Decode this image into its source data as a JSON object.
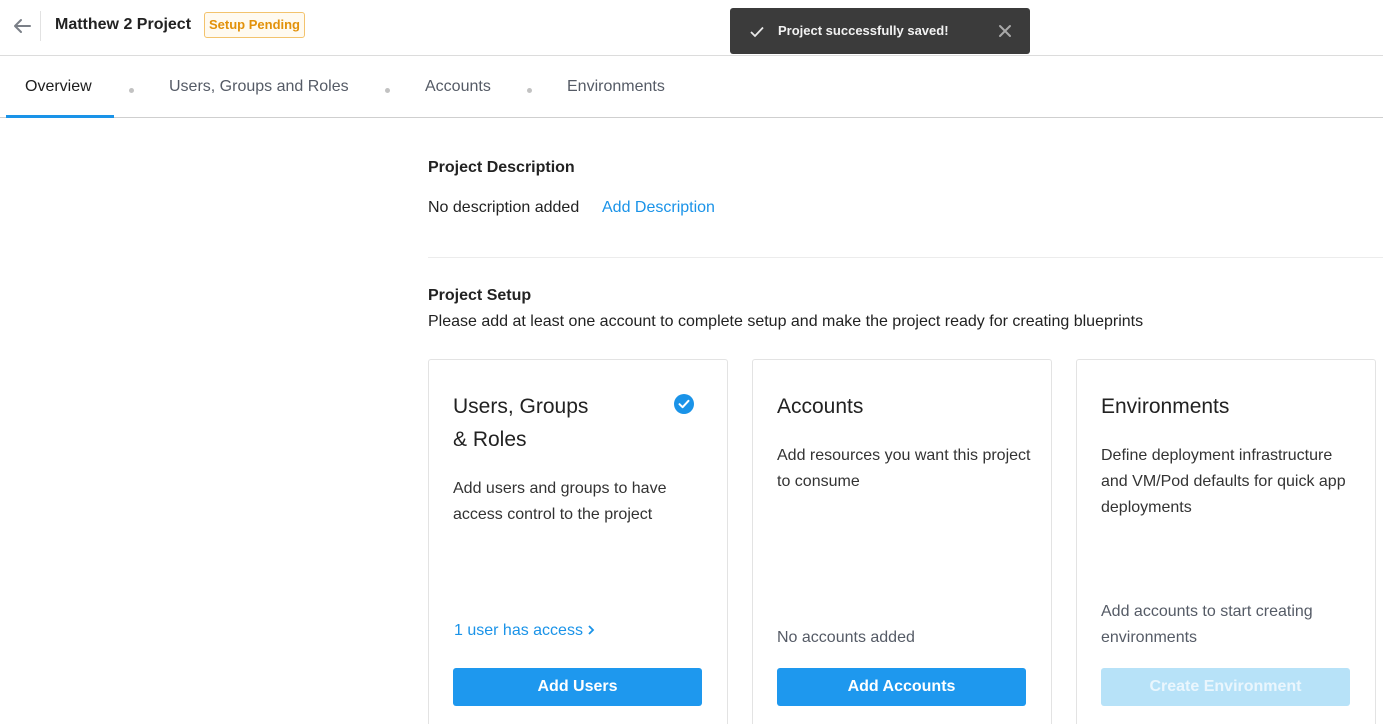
{
  "header": {
    "project_title": "Matthew 2 Project",
    "status_badge": "Setup Pending",
    "back_icon": "arrow-left-icon"
  },
  "toast": {
    "message": "Project successfully saved!",
    "check_icon": "check-icon",
    "close_icon": "close-icon"
  },
  "tabs": [
    {
      "label": "Overview",
      "active": true
    },
    {
      "label": "Users, Groups and Roles",
      "active": false
    },
    {
      "label": "Accounts",
      "active": false
    },
    {
      "label": "Environments",
      "active": false
    }
  ],
  "description": {
    "title": "Project Description",
    "empty_text": "No description added",
    "add_link": "Add Description"
  },
  "setup": {
    "title": "Project Setup",
    "subtitle": "Please add at least one account to complete setup and make the project ready for creating blueprints"
  },
  "cards": [
    {
      "title_line1": "Users, Groups",
      "title_line2": "& Roles",
      "description": "Add users and groups to have access control to the project",
      "complete": true,
      "footer_link": "1 user has access",
      "button": "Add Users",
      "button_enabled": true
    },
    {
      "title": "Accounts",
      "description": "Add resources you want this project to consume",
      "footer_text": "No accounts added",
      "button": "Add Accounts",
      "button_enabled": true
    },
    {
      "title": "Environments",
      "description": "Define deployment infrastructure and VM/Pod defaults for quick app deployments",
      "footer_text": "Add accounts to start creating environments",
      "button": "Create Environment",
      "button_enabled": false
    }
  ],
  "colors": {
    "accent": "#1a93e8",
    "button_primary": "#1e98ee",
    "button_disabled": "#b7e2f8",
    "badge_warning": "#e2910a",
    "toast_bg": "#3b3b3b"
  }
}
